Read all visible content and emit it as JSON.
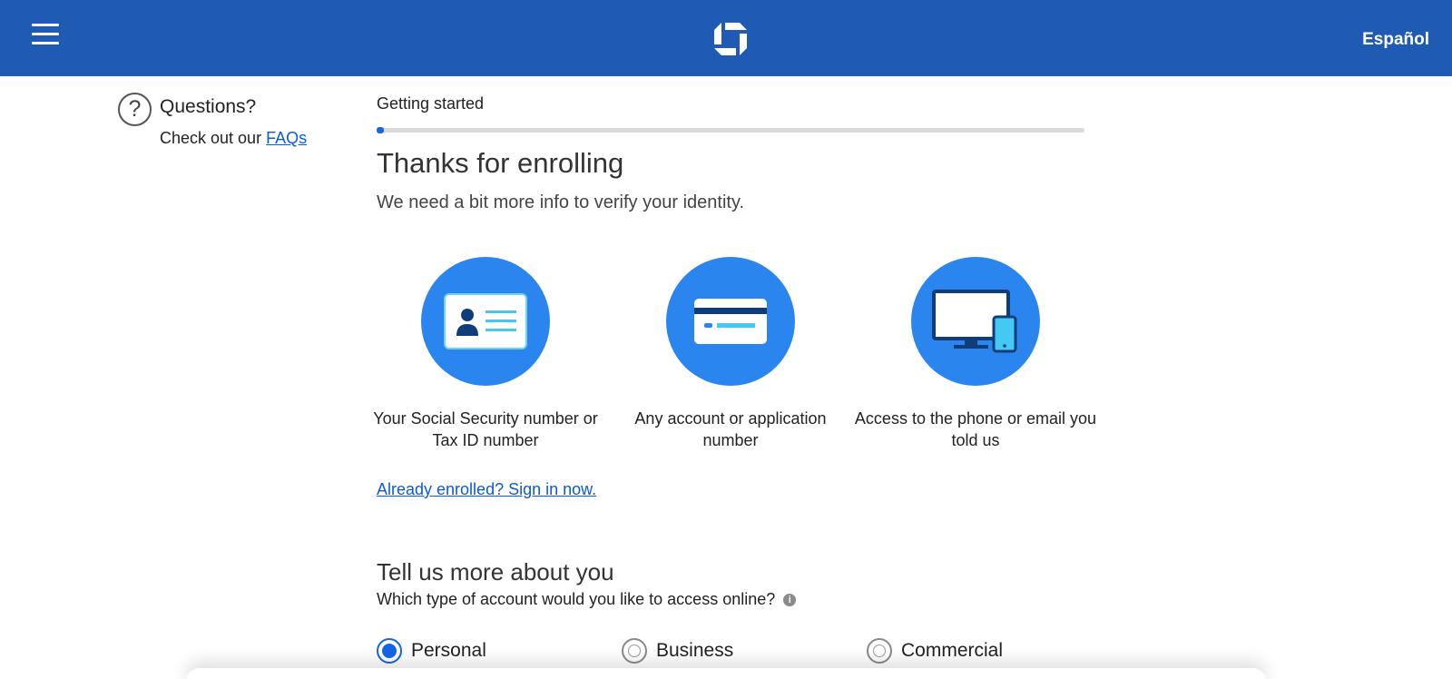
{
  "header": {
    "language_link": "Español",
    "brand_color": "#1f5bb5"
  },
  "help": {
    "title": "Questions?",
    "sub_prefix": "Check out our ",
    "faq_link": "FAQs"
  },
  "progress": {
    "step_label": "Getting started",
    "percent": 1
  },
  "main": {
    "title": "Thanks for enrolling",
    "subtitle": "We need a bit more info to verify your identity.",
    "items": [
      {
        "icon": "id-card-icon",
        "caption": "Your Social Security number or Tax ID number"
      },
      {
        "icon": "credit-card-icon",
        "caption": "Any account or application number"
      },
      {
        "icon": "devices-icon",
        "caption": "Access to the phone or email you told us"
      }
    ],
    "signin_link": "Already enrolled? Sign in now."
  },
  "about": {
    "title": "Tell us more about you",
    "question": "Which type of account would you like to access online?",
    "info_icon": "i",
    "options": [
      {
        "label": "Personal",
        "selected": true
      },
      {
        "label": "Business",
        "selected": false
      },
      {
        "label": "Commercial",
        "selected": false
      }
    ]
  },
  "colors": {
    "accent": "#1466e6",
    "circle": "#2a86ee"
  }
}
